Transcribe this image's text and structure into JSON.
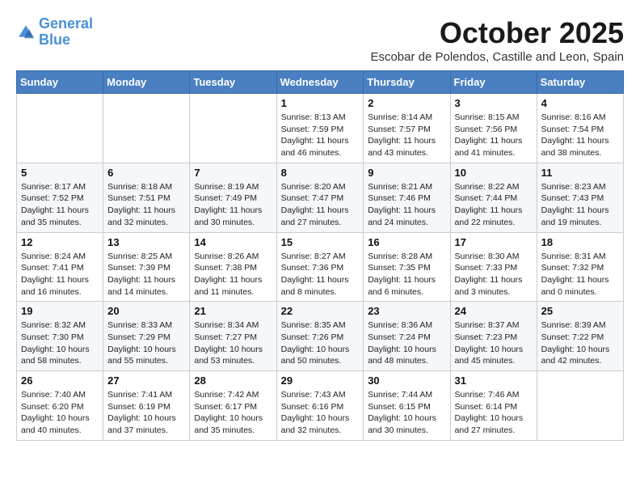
{
  "logo": {
    "line1": "General",
    "line2": "Blue"
  },
  "title": "October 2025",
  "subtitle": "Escobar de Polendos, Castille and Leon, Spain",
  "weekdays": [
    "Sunday",
    "Monday",
    "Tuesday",
    "Wednesday",
    "Thursday",
    "Friday",
    "Saturday"
  ],
  "weeks": [
    [
      {
        "day": "",
        "info": ""
      },
      {
        "day": "",
        "info": ""
      },
      {
        "day": "",
        "info": ""
      },
      {
        "day": "1",
        "info": "Sunrise: 8:13 AM\nSunset: 7:59 PM\nDaylight: 11 hours and 46 minutes."
      },
      {
        "day": "2",
        "info": "Sunrise: 8:14 AM\nSunset: 7:57 PM\nDaylight: 11 hours and 43 minutes."
      },
      {
        "day": "3",
        "info": "Sunrise: 8:15 AM\nSunset: 7:56 PM\nDaylight: 11 hours and 41 minutes."
      },
      {
        "day": "4",
        "info": "Sunrise: 8:16 AM\nSunset: 7:54 PM\nDaylight: 11 hours and 38 minutes."
      }
    ],
    [
      {
        "day": "5",
        "info": "Sunrise: 8:17 AM\nSunset: 7:52 PM\nDaylight: 11 hours and 35 minutes."
      },
      {
        "day": "6",
        "info": "Sunrise: 8:18 AM\nSunset: 7:51 PM\nDaylight: 11 hours and 32 minutes."
      },
      {
        "day": "7",
        "info": "Sunrise: 8:19 AM\nSunset: 7:49 PM\nDaylight: 11 hours and 30 minutes."
      },
      {
        "day": "8",
        "info": "Sunrise: 8:20 AM\nSunset: 7:47 PM\nDaylight: 11 hours and 27 minutes."
      },
      {
        "day": "9",
        "info": "Sunrise: 8:21 AM\nSunset: 7:46 PM\nDaylight: 11 hours and 24 minutes."
      },
      {
        "day": "10",
        "info": "Sunrise: 8:22 AM\nSunset: 7:44 PM\nDaylight: 11 hours and 22 minutes."
      },
      {
        "day": "11",
        "info": "Sunrise: 8:23 AM\nSunset: 7:43 PM\nDaylight: 11 hours and 19 minutes."
      }
    ],
    [
      {
        "day": "12",
        "info": "Sunrise: 8:24 AM\nSunset: 7:41 PM\nDaylight: 11 hours and 16 minutes."
      },
      {
        "day": "13",
        "info": "Sunrise: 8:25 AM\nSunset: 7:39 PM\nDaylight: 11 hours and 14 minutes."
      },
      {
        "day": "14",
        "info": "Sunrise: 8:26 AM\nSunset: 7:38 PM\nDaylight: 11 hours and 11 minutes."
      },
      {
        "day": "15",
        "info": "Sunrise: 8:27 AM\nSunset: 7:36 PM\nDaylight: 11 hours and 8 minutes."
      },
      {
        "day": "16",
        "info": "Sunrise: 8:28 AM\nSunset: 7:35 PM\nDaylight: 11 hours and 6 minutes."
      },
      {
        "day": "17",
        "info": "Sunrise: 8:30 AM\nSunset: 7:33 PM\nDaylight: 11 hours and 3 minutes."
      },
      {
        "day": "18",
        "info": "Sunrise: 8:31 AM\nSunset: 7:32 PM\nDaylight: 11 hours and 0 minutes."
      }
    ],
    [
      {
        "day": "19",
        "info": "Sunrise: 8:32 AM\nSunset: 7:30 PM\nDaylight: 10 hours and 58 minutes."
      },
      {
        "day": "20",
        "info": "Sunrise: 8:33 AM\nSunset: 7:29 PM\nDaylight: 10 hours and 55 minutes."
      },
      {
        "day": "21",
        "info": "Sunrise: 8:34 AM\nSunset: 7:27 PM\nDaylight: 10 hours and 53 minutes."
      },
      {
        "day": "22",
        "info": "Sunrise: 8:35 AM\nSunset: 7:26 PM\nDaylight: 10 hours and 50 minutes."
      },
      {
        "day": "23",
        "info": "Sunrise: 8:36 AM\nSunset: 7:24 PM\nDaylight: 10 hours and 48 minutes."
      },
      {
        "day": "24",
        "info": "Sunrise: 8:37 AM\nSunset: 7:23 PM\nDaylight: 10 hours and 45 minutes."
      },
      {
        "day": "25",
        "info": "Sunrise: 8:39 AM\nSunset: 7:22 PM\nDaylight: 10 hours and 42 minutes."
      }
    ],
    [
      {
        "day": "26",
        "info": "Sunrise: 7:40 AM\nSunset: 6:20 PM\nDaylight: 10 hours and 40 minutes."
      },
      {
        "day": "27",
        "info": "Sunrise: 7:41 AM\nSunset: 6:19 PM\nDaylight: 10 hours and 37 minutes."
      },
      {
        "day": "28",
        "info": "Sunrise: 7:42 AM\nSunset: 6:17 PM\nDaylight: 10 hours and 35 minutes."
      },
      {
        "day": "29",
        "info": "Sunrise: 7:43 AM\nSunset: 6:16 PM\nDaylight: 10 hours and 32 minutes."
      },
      {
        "day": "30",
        "info": "Sunrise: 7:44 AM\nSunset: 6:15 PM\nDaylight: 10 hours and 30 minutes."
      },
      {
        "day": "31",
        "info": "Sunrise: 7:46 AM\nSunset: 6:14 PM\nDaylight: 10 hours and 27 minutes."
      },
      {
        "day": "",
        "info": ""
      }
    ]
  ]
}
